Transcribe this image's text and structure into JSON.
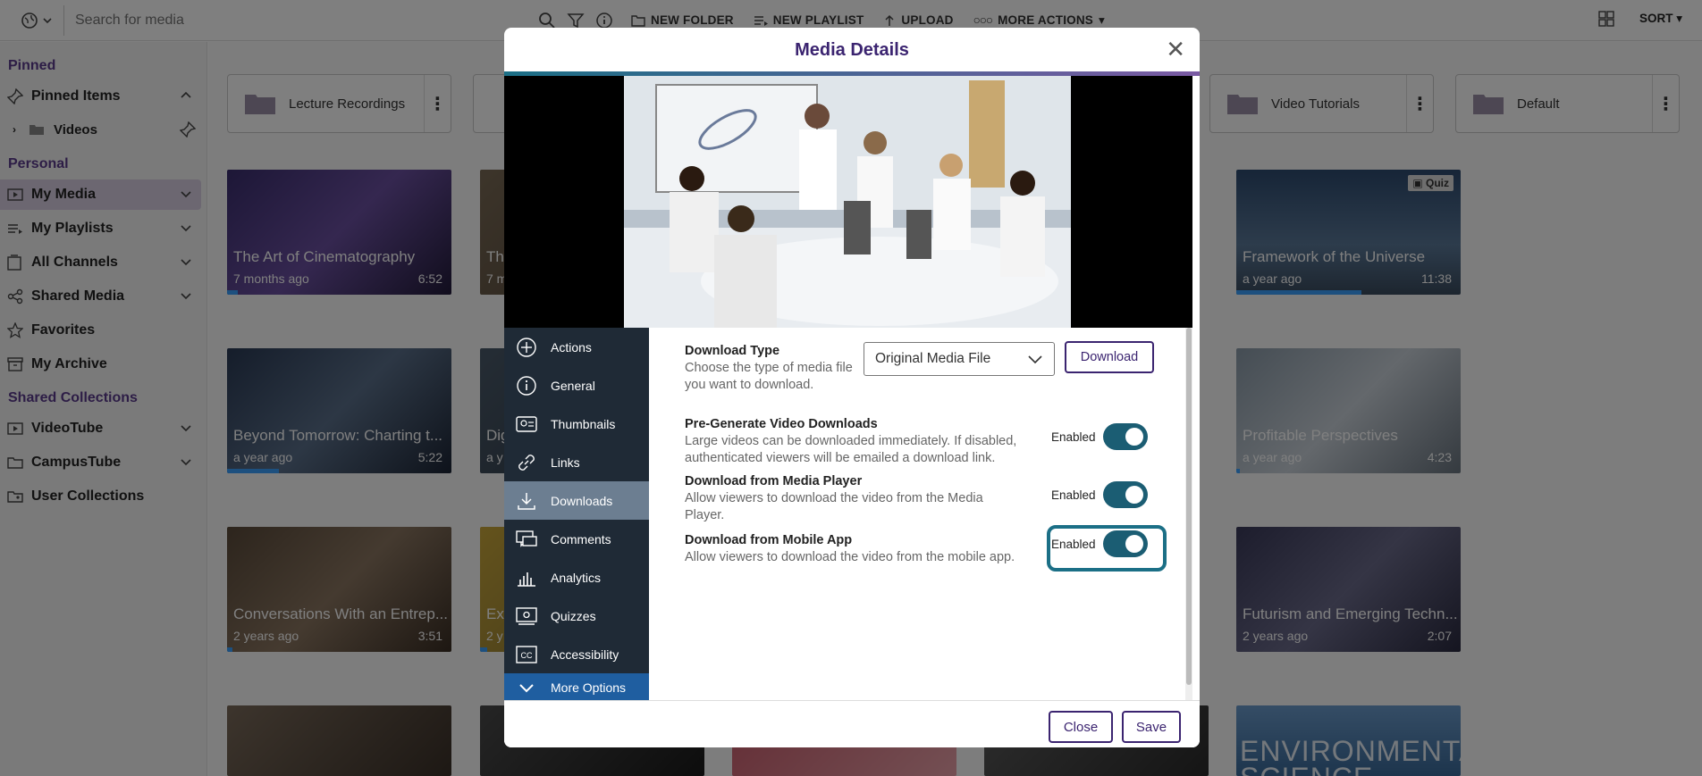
{
  "topbar": {
    "search_placeholder": "Search for media",
    "actions": [
      "NEW FOLDER",
      "NEW PLAYLIST",
      "UPLOAD",
      "MORE ACTIONS"
    ],
    "sort_label": "SORT"
  },
  "sidebar": {
    "pinned_title": "Pinned",
    "pinned_items": "Pinned Items",
    "videos": "Videos",
    "personal_title": "Personal",
    "personal": [
      "My Media",
      "My Playlists",
      "All Channels",
      "Shared Media",
      "Favorites",
      "My Archive"
    ],
    "shared_title": "Shared Collections",
    "shared": [
      "VideoTube",
      "CampusTube",
      "User Collections"
    ]
  },
  "folders": [
    "Lecture Recordings",
    "Video Tutorials",
    "Default"
  ],
  "thumbs": [
    {
      "title": "The Art of Cinematography",
      "age": "7 months ago",
      "dur": "6:52"
    },
    {
      "title": "Th",
      "age": "7 m",
      "dur": ""
    },
    {
      "title": "Framework of the Universe",
      "age": "a year ago",
      "dur": "11:38",
      "badge": "Quiz"
    },
    {
      "title": "Beyond Tomorrow: Charting t...",
      "age": "a year ago",
      "dur": "5:22"
    },
    {
      "title": "Dig",
      "age": "a y",
      "dur": ""
    },
    {
      "title": "Profitable Perspectives",
      "age": "a year ago",
      "dur": "4:23"
    },
    {
      "title": "Conversations With an Entrep...",
      "age": "2 years ago",
      "dur": "3:51"
    },
    {
      "title": "Ex",
      "age": "2 y",
      "dur": ""
    },
    {
      "title": "Futurism and Emerging Techn...",
      "age": "2 years ago",
      "dur": "2:07"
    },
    {
      "title": "ENVIRONMENTAL SCIENCE",
      "age": "",
      "dur": ""
    }
  ],
  "modal": {
    "title": "Media Details",
    "nav": [
      "Actions",
      "General",
      "Thumbnails",
      "Links",
      "Downloads",
      "Comments",
      "Analytics",
      "Quizzes",
      "Accessibility",
      "More Options"
    ],
    "download_type": {
      "title": "Download Type",
      "desc": "Choose the type of media file you want to download.",
      "selected": "Original Media File",
      "button": "Download"
    },
    "settings": [
      {
        "title": "Pre-Generate Video Downloads",
        "desc": "Large videos can be downloaded immediately. If disabled, authenticated viewers will be emailed a download link.",
        "state": "Enabled"
      },
      {
        "title": "Download from Media Player",
        "desc": "Allow viewers to download the video from the Media Player.",
        "state": "Enabled"
      },
      {
        "title": "Download from Mobile App",
        "desc": "Allow viewers to download the video from the mobile app.",
        "state": "Enabled"
      }
    ],
    "close_label": "Close",
    "save_label": "Save"
  },
  "colors": {
    "brand_purple": "#3b2470",
    "accent_teal": "#1b6f86",
    "nav_bg": "#1f2a36",
    "nav_active": "#6c7e91",
    "more_options": "#1f5ea0",
    "toggle_on": "#1b5d73"
  }
}
